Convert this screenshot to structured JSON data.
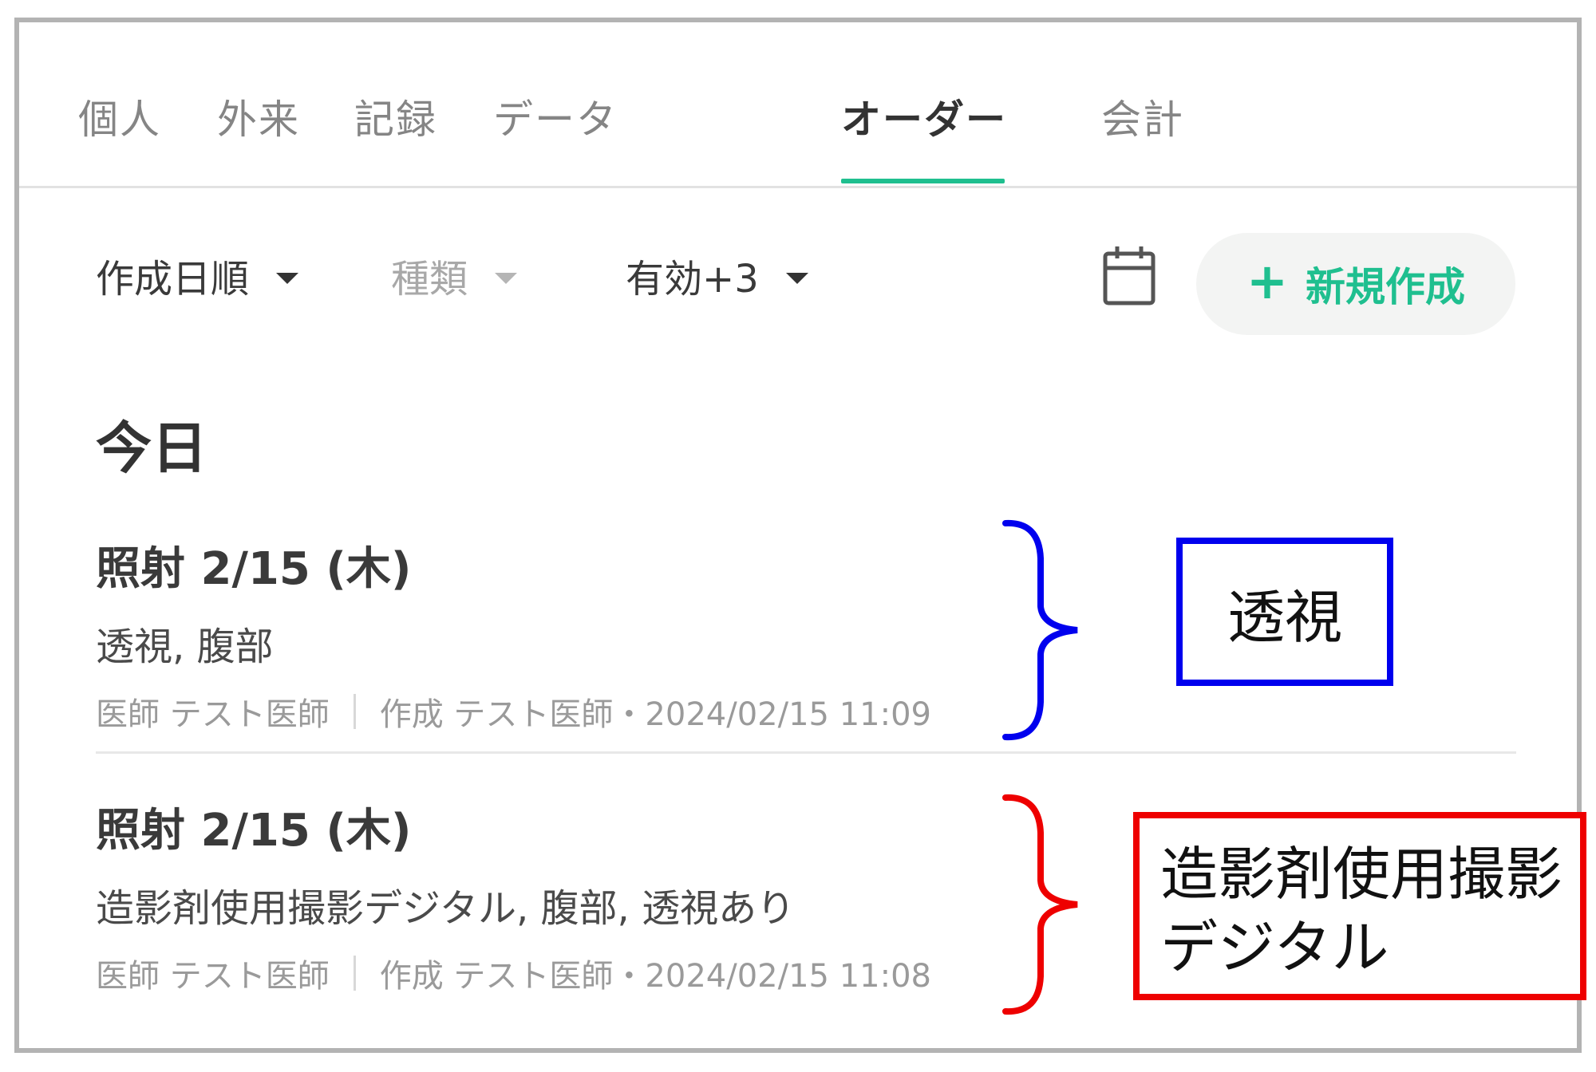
{
  "tabs": [
    {
      "label": "個人",
      "active": false
    },
    {
      "label": "外来",
      "active": false
    },
    {
      "label": "記録",
      "active": false
    },
    {
      "label": "データ",
      "active": false
    },
    {
      "label": "オーダー",
      "active": true
    },
    {
      "label": "会計",
      "active": false
    }
  ],
  "toolbar": {
    "sort_label": "作成日順",
    "type_label": "種類",
    "status_label": "有効+3",
    "calendar_icon": "calendar-icon",
    "new_button_label": "新規作成",
    "accent_color": "#1fbf8f"
  },
  "section_title": "今日",
  "orders": [
    {
      "title": "照射  2/15 (木)",
      "description": "透視, 腹部",
      "doctor": "医師 テスト医師",
      "created": "作成 テスト医師・2024/02/15 11:09"
    },
    {
      "title": "照射  2/15 (木)",
      "description": "造影剤使用撮影デジタル, 腹部, 透視あり",
      "doctor": "医師 テスト医師",
      "created": "作成 テスト医師・2024/02/15 11:08"
    }
  ],
  "annotations": [
    {
      "text": "透視",
      "color": "#0000ee"
    },
    {
      "line1": "造影剤使用撮影",
      "line2": "デジタル",
      "color": "#ee0000"
    }
  ]
}
